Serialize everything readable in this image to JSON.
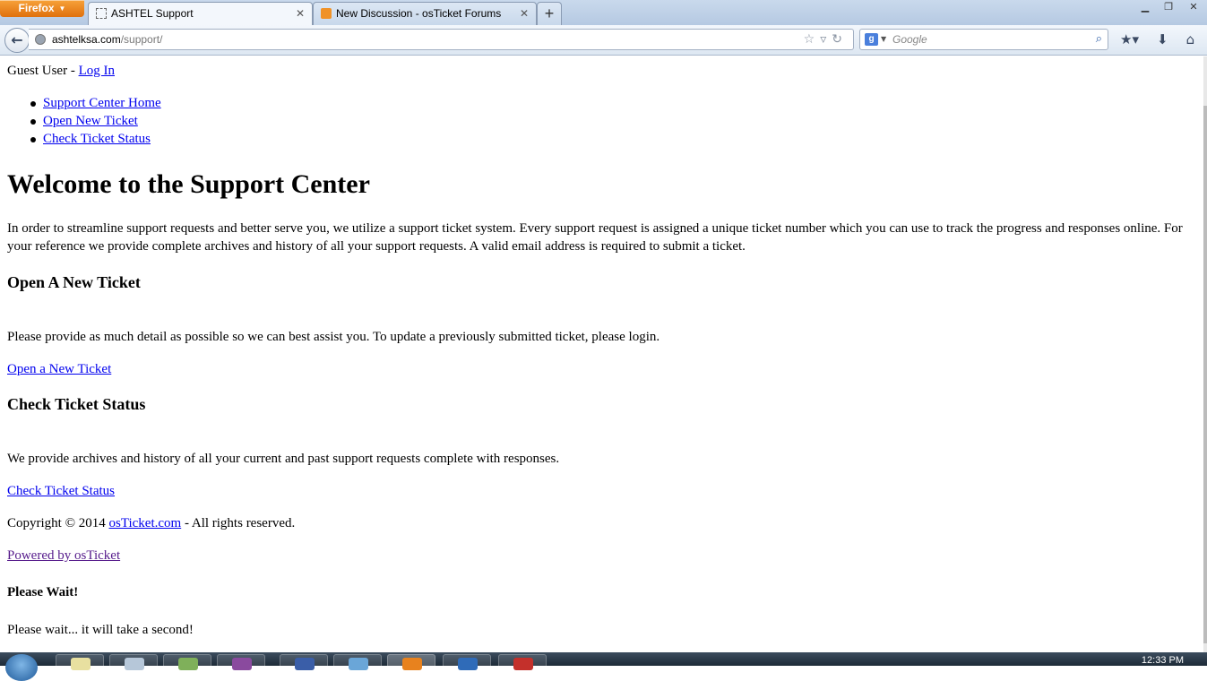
{
  "browser": {
    "menu_button": "Firefox",
    "tabs": [
      {
        "title": "ASHTEL Support",
        "active": true
      },
      {
        "title": "New Discussion - osTicket Forums",
        "active": false
      }
    ],
    "new_tab": "+",
    "url_host": "ashtelksa.com",
    "url_path": "/support/",
    "search_placeholder": "Google",
    "search_engine_icon": "google-icon",
    "window_controls": [
      "minimize-icon",
      "restore-icon",
      "close-icon"
    ]
  },
  "page": {
    "guest_prefix": "Guest User - ",
    "login_link": "Log In",
    "nav": [
      "Support Center Home",
      "Open New Ticket",
      "Check Ticket Status"
    ],
    "title": "Welcome to the Support Center",
    "intro": "In order to streamline support requests and better serve you, we utilize a support ticket system. Every support request is assigned a unique ticket number which you can use to track the progress and responses online. For your reference we provide complete archives and history of all your support requests. A valid email address is required to submit a ticket.",
    "open_section": {
      "heading": "Open A New Ticket",
      "text": "Please provide as much detail as possible so we can best assist you. To update a previously submitted ticket, please login.",
      "link": "Open a New Ticket"
    },
    "check_section": {
      "heading": "Check Ticket Status",
      "text": "We provide archives and history of all your current and past support requests complete with responses.",
      "link": "Check Ticket Status"
    },
    "copyright_prefix": "Copyright © 2014 ",
    "copyright_link": "osTicket.com",
    "copyright_suffix": " - All rights reserved.",
    "powered_link": "Powered by osTicket",
    "wait_title": "Please Wait!",
    "wait_text": "Please wait... it will take a second!"
  },
  "taskbar": {
    "clock": "12:33 PM"
  },
  "colors": {
    "link": "#0000ee",
    "visited_link": "#551a8b",
    "firefox_button": "#e8821e"
  }
}
